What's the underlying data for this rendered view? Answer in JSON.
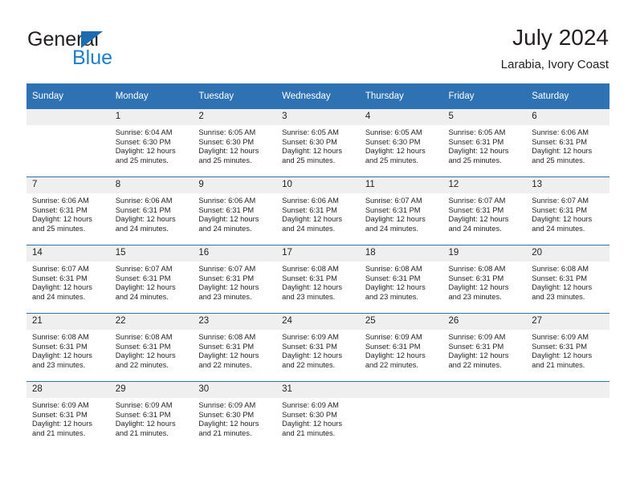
{
  "brand": {
    "name_part1": "General",
    "name_part2": "Blue",
    "triangle_color": "#1b6cb0",
    "blue_color": "#1b7fd0"
  },
  "header": {
    "title": "July 2024",
    "subtitle": "Larabia, Ivory Coast"
  },
  "theme": {
    "header_bg": "#2f72b4",
    "daynum_bg": "#efefef",
    "text": "#231f20"
  },
  "calendar": {
    "weekday_headers": [
      "Sunday",
      "Monday",
      "Tuesday",
      "Wednesday",
      "Thursday",
      "Friday",
      "Saturday"
    ],
    "weeks": [
      [
        {
          "day": "",
          "sunrise": "",
          "sunset": "",
          "daylight_line1": "",
          "daylight_line2": ""
        },
        {
          "day": "1",
          "sunrise": "Sunrise: 6:04 AM",
          "sunset": "Sunset: 6:30 PM",
          "daylight_line1": "Daylight: 12 hours",
          "daylight_line2": "and 25 minutes."
        },
        {
          "day": "2",
          "sunrise": "Sunrise: 6:05 AM",
          "sunset": "Sunset: 6:30 PM",
          "daylight_line1": "Daylight: 12 hours",
          "daylight_line2": "and 25 minutes."
        },
        {
          "day": "3",
          "sunrise": "Sunrise: 6:05 AM",
          "sunset": "Sunset: 6:30 PM",
          "daylight_line1": "Daylight: 12 hours",
          "daylight_line2": "and 25 minutes."
        },
        {
          "day": "4",
          "sunrise": "Sunrise: 6:05 AM",
          "sunset": "Sunset: 6:30 PM",
          "daylight_line1": "Daylight: 12 hours",
          "daylight_line2": "and 25 minutes."
        },
        {
          "day": "5",
          "sunrise": "Sunrise: 6:05 AM",
          "sunset": "Sunset: 6:31 PM",
          "daylight_line1": "Daylight: 12 hours",
          "daylight_line2": "and 25 minutes."
        },
        {
          "day": "6",
          "sunrise": "Sunrise: 6:06 AM",
          "sunset": "Sunset: 6:31 PM",
          "daylight_line1": "Daylight: 12 hours",
          "daylight_line2": "and 25 minutes."
        }
      ],
      [
        {
          "day": "7",
          "sunrise": "Sunrise: 6:06 AM",
          "sunset": "Sunset: 6:31 PM",
          "daylight_line1": "Daylight: 12 hours",
          "daylight_line2": "and 25 minutes."
        },
        {
          "day": "8",
          "sunrise": "Sunrise: 6:06 AM",
          "sunset": "Sunset: 6:31 PM",
          "daylight_line1": "Daylight: 12 hours",
          "daylight_line2": "and 24 minutes."
        },
        {
          "day": "9",
          "sunrise": "Sunrise: 6:06 AM",
          "sunset": "Sunset: 6:31 PM",
          "daylight_line1": "Daylight: 12 hours",
          "daylight_line2": "and 24 minutes."
        },
        {
          "day": "10",
          "sunrise": "Sunrise: 6:06 AM",
          "sunset": "Sunset: 6:31 PM",
          "daylight_line1": "Daylight: 12 hours",
          "daylight_line2": "and 24 minutes."
        },
        {
          "day": "11",
          "sunrise": "Sunrise: 6:07 AM",
          "sunset": "Sunset: 6:31 PM",
          "daylight_line1": "Daylight: 12 hours",
          "daylight_line2": "and 24 minutes."
        },
        {
          "day": "12",
          "sunrise": "Sunrise: 6:07 AM",
          "sunset": "Sunset: 6:31 PM",
          "daylight_line1": "Daylight: 12 hours",
          "daylight_line2": "and 24 minutes."
        },
        {
          "day": "13",
          "sunrise": "Sunrise: 6:07 AM",
          "sunset": "Sunset: 6:31 PM",
          "daylight_line1": "Daylight: 12 hours",
          "daylight_line2": "and 24 minutes."
        }
      ],
      [
        {
          "day": "14",
          "sunrise": "Sunrise: 6:07 AM",
          "sunset": "Sunset: 6:31 PM",
          "daylight_line1": "Daylight: 12 hours",
          "daylight_line2": "and 24 minutes."
        },
        {
          "day": "15",
          "sunrise": "Sunrise: 6:07 AM",
          "sunset": "Sunset: 6:31 PM",
          "daylight_line1": "Daylight: 12 hours",
          "daylight_line2": "and 24 minutes."
        },
        {
          "day": "16",
          "sunrise": "Sunrise: 6:07 AM",
          "sunset": "Sunset: 6:31 PM",
          "daylight_line1": "Daylight: 12 hours",
          "daylight_line2": "and 23 minutes."
        },
        {
          "day": "17",
          "sunrise": "Sunrise: 6:08 AM",
          "sunset": "Sunset: 6:31 PM",
          "daylight_line1": "Daylight: 12 hours",
          "daylight_line2": "and 23 minutes."
        },
        {
          "day": "18",
          "sunrise": "Sunrise: 6:08 AM",
          "sunset": "Sunset: 6:31 PM",
          "daylight_line1": "Daylight: 12 hours",
          "daylight_line2": "and 23 minutes."
        },
        {
          "day": "19",
          "sunrise": "Sunrise: 6:08 AM",
          "sunset": "Sunset: 6:31 PM",
          "daylight_line1": "Daylight: 12 hours",
          "daylight_line2": "and 23 minutes."
        },
        {
          "day": "20",
          "sunrise": "Sunrise: 6:08 AM",
          "sunset": "Sunset: 6:31 PM",
          "daylight_line1": "Daylight: 12 hours",
          "daylight_line2": "and 23 minutes."
        }
      ],
      [
        {
          "day": "21",
          "sunrise": "Sunrise: 6:08 AM",
          "sunset": "Sunset: 6:31 PM",
          "daylight_line1": "Daylight: 12 hours",
          "daylight_line2": "and 23 minutes."
        },
        {
          "day": "22",
          "sunrise": "Sunrise: 6:08 AM",
          "sunset": "Sunset: 6:31 PM",
          "daylight_line1": "Daylight: 12 hours",
          "daylight_line2": "and 22 minutes."
        },
        {
          "day": "23",
          "sunrise": "Sunrise: 6:08 AM",
          "sunset": "Sunset: 6:31 PM",
          "daylight_line1": "Daylight: 12 hours",
          "daylight_line2": "and 22 minutes."
        },
        {
          "day": "24",
          "sunrise": "Sunrise: 6:09 AM",
          "sunset": "Sunset: 6:31 PM",
          "daylight_line1": "Daylight: 12 hours",
          "daylight_line2": "and 22 minutes."
        },
        {
          "day": "25",
          "sunrise": "Sunrise: 6:09 AM",
          "sunset": "Sunset: 6:31 PM",
          "daylight_line1": "Daylight: 12 hours",
          "daylight_line2": "and 22 minutes."
        },
        {
          "day": "26",
          "sunrise": "Sunrise: 6:09 AM",
          "sunset": "Sunset: 6:31 PM",
          "daylight_line1": "Daylight: 12 hours",
          "daylight_line2": "and 22 minutes."
        },
        {
          "day": "27",
          "sunrise": "Sunrise: 6:09 AM",
          "sunset": "Sunset: 6:31 PM",
          "daylight_line1": "Daylight: 12 hours",
          "daylight_line2": "and 21 minutes."
        }
      ],
      [
        {
          "day": "28",
          "sunrise": "Sunrise: 6:09 AM",
          "sunset": "Sunset: 6:31 PM",
          "daylight_line1": "Daylight: 12 hours",
          "daylight_line2": "and 21 minutes."
        },
        {
          "day": "29",
          "sunrise": "Sunrise: 6:09 AM",
          "sunset": "Sunset: 6:31 PM",
          "daylight_line1": "Daylight: 12 hours",
          "daylight_line2": "and 21 minutes."
        },
        {
          "day": "30",
          "sunrise": "Sunrise: 6:09 AM",
          "sunset": "Sunset: 6:30 PM",
          "daylight_line1": "Daylight: 12 hours",
          "daylight_line2": "and 21 minutes."
        },
        {
          "day": "31",
          "sunrise": "Sunrise: 6:09 AM",
          "sunset": "Sunset: 6:30 PM",
          "daylight_line1": "Daylight: 12 hours",
          "daylight_line2": "and 21 minutes."
        },
        {
          "day": "",
          "sunrise": "",
          "sunset": "",
          "daylight_line1": "",
          "daylight_line2": ""
        },
        {
          "day": "",
          "sunrise": "",
          "sunset": "",
          "daylight_line1": "",
          "daylight_line2": ""
        },
        {
          "day": "",
          "sunrise": "",
          "sunset": "",
          "daylight_line1": "",
          "daylight_line2": ""
        }
      ]
    ]
  }
}
